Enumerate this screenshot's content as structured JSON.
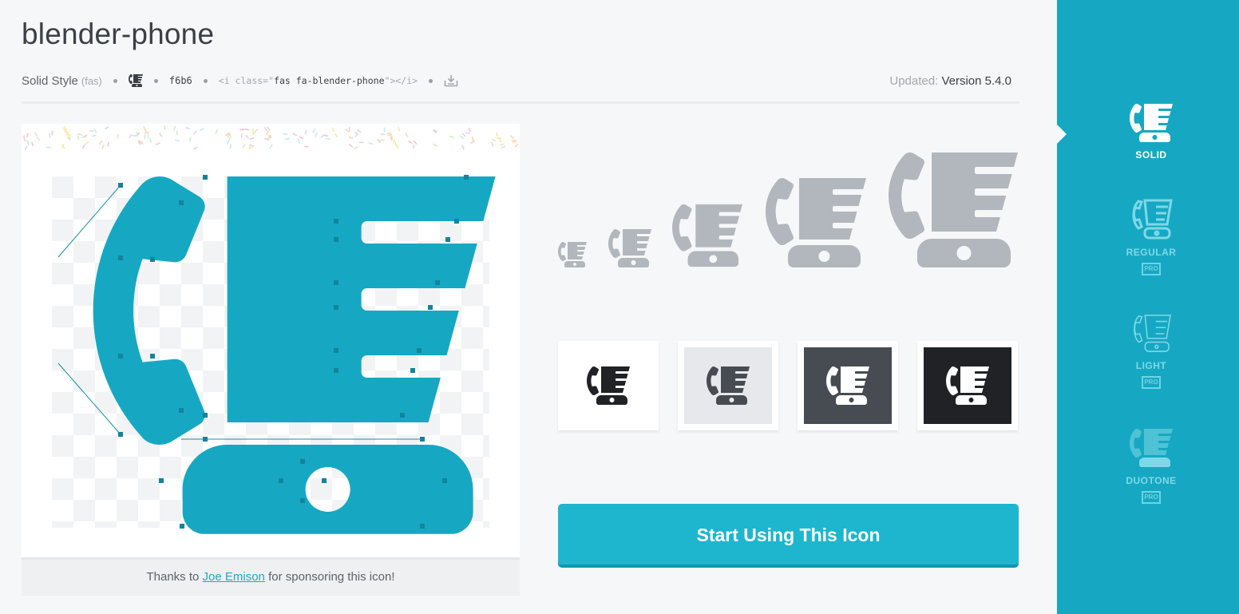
{
  "icon": {
    "name": "blender-phone",
    "style_label": "Solid Style",
    "style_prefix": "(fas)",
    "unicode": "f6b6",
    "html_code_prefix": "<i class=\"",
    "html_code_class": "fas fa-blender-phone",
    "html_code_suffix": "\"></i>",
    "updated_label": "Updated:",
    "updated_version": "Version 5.4.0"
  },
  "sponsor": {
    "prefix": "Thanks to ",
    "name": "Joe Emison",
    "suffix": " for sponsoring this icon!"
  },
  "cta": {
    "label": "Start Using This Icon"
  },
  "styles": [
    {
      "label": "SOLID",
      "active": true,
      "pro": false
    },
    {
      "label": "REGULAR",
      "active": false,
      "pro": true,
      "pro_label": "PRO"
    },
    {
      "label": "LIGHT",
      "active": false,
      "pro": true,
      "pro_label": "PRO"
    },
    {
      "label": "DUOTONE",
      "active": false,
      "pro": true,
      "pro_label": "PRO"
    }
  ],
  "colors": {
    "brand": "#16a8c2",
    "cta": "#1eb5cf",
    "icon_preview": "#b2b7bd",
    "icon_fill": "#16a8c2"
  },
  "swatches": [
    {
      "bg": "#ffffff",
      "fg": "#202226"
    },
    {
      "bg": "#e6e8eb",
      "fg": "#474b52"
    },
    {
      "bg": "#474b52",
      "fg": "#ffffff"
    },
    {
      "bg": "#202226",
      "fg": "#ffffff"
    }
  ]
}
